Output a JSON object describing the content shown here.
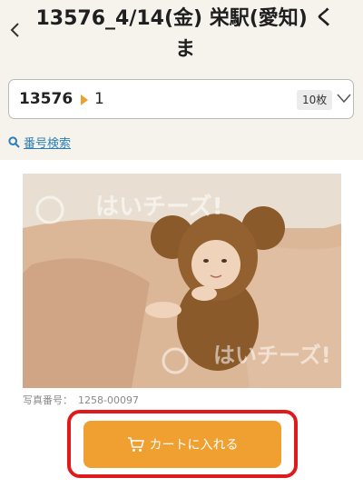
{
  "header": {
    "title": "13576_4/14(金) 栄駅(愛知) くま"
  },
  "album_selector": {
    "code": "13576",
    "number": "1",
    "count_badge": "10枚"
  },
  "search_link": {
    "label": "番号検索"
  },
  "photo": {
    "watermark": "はいチーズ!",
    "number_label": "写真番号：",
    "number_value": "1258-00097"
  },
  "cart_button": {
    "label": "カートに入れる"
  },
  "colors": {
    "accent": "#f0a030",
    "highlight": "#e01a1a",
    "link": "#2c7fb8",
    "header_bg": "#f6f3ec"
  },
  "icons": {
    "back": "back-chevron-icon",
    "dropdown": "chevron-down-icon",
    "search": "search-icon",
    "cart": "cart-icon"
  }
}
